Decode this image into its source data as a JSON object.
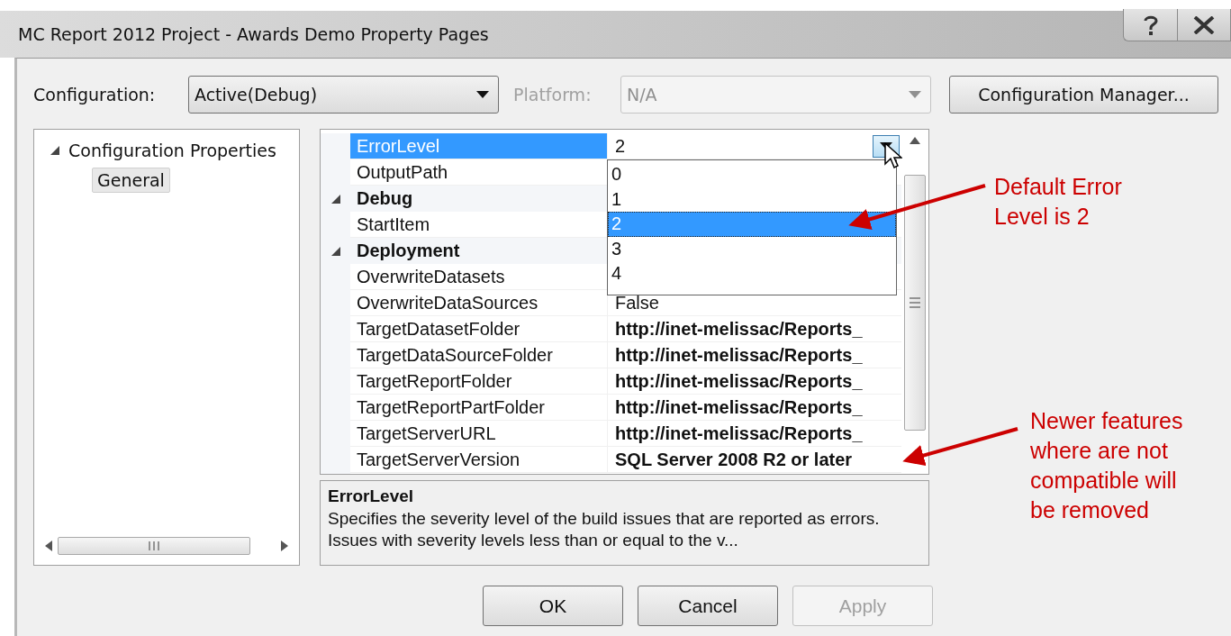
{
  "window": {
    "title": "MC Report 2012 Project - Awards Demo Property Pages"
  },
  "configuration": {
    "label": "Configuration:",
    "value": "Active(Debug)",
    "disabled": false
  },
  "platform": {
    "label": "Platform:",
    "value": "N/A",
    "disabled": true
  },
  "configuration_manager": {
    "label": "Configuration Manager..."
  },
  "tree": {
    "items": [
      {
        "label": "Configuration Properties",
        "expanded": true,
        "children": [
          {
            "label": "General",
            "selected": true
          }
        ]
      }
    ]
  },
  "grid": {
    "rows": [
      {
        "kind": "property",
        "name": "ErrorLevel",
        "value": "2",
        "selected": true,
        "modified": false,
        "editor": true
      },
      {
        "kind": "property",
        "name": "OutputPath",
        "selected": false
      },
      {
        "kind": "category",
        "name": "Debug",
        "expanded": true
      },
      {
        "kind": "property",
        "name": "StartItem",
        "selected": false
      },
      {
        "kind": "category",
        "name": "Deployment",
        "expanded": true
      },
      {
        "kind": "property",
        "name": "OverwriteDatasets",
        "selected": false
      },
      {
        "kind": "property",
        "name": "OverwriteDataSources",
        "value": "False",
        "selected": false,
        "modified": false
      },
      {
        "kind": "property",
        "name": "TargetDatasetFolder",
        "value": "http://inet-melissac/Reports_",
        "selected": false,
        "modified": true
      },
      {
        "kind": "property",
        "name": "TargetDataSourceFolder",
        "value": "http://inet-melissac/Reports_",
        "selected": false,
        "modified": true
      },
      {
        "kind": "property",
        "name": "TargetReportFolder",
        "value": "http://inet-melissac/Reports_",
        "selected": false,
        "modified": true
      },
      {
        "kind": "property",
        "name": "TargetReportPartFolder",
        "value": "http://inet-melissac/Reports_",
        "selected": false,
        "modified": true
      },
      {
        "kind": "property",
        "name": "TargetServerURL",
        "value": "http://inet-melissac/Reports_",
        "selected": false,
        "modified": true
      },
      {
        "kind": "property",
        "name": "TargetServerVersion",
        "value": "SQL Server 2008 R2 or later",
        "selected": false,
        "modified": true
      }
    ]
  },
  "dropdown": {
    "options": [
      {
        "label": "0",
        "selected": false
      },
      {
        "label": "1",
        "selected": false
      },
      {
        "label": "2",
        "selected": true
      },
      {
        "label": "3",
        "selected": false
      },
      {
        "label": "4",
        "selected": false
      }
    ]
  },
  "description": {
    "title": "ErrorLevel",
    "text": "Specifies the severity level of the build issues that are reported as errors. Issues with severity levels less than or equal to the v..."
  },
  "buttons": [
    {
      "label": "OK",
      "disabled": false
    },
    {
      "label": "Cancel",
      "disabled": false
    },
    {
      "label": "Apply",
      "disabled": true
    }
  ],
  "annotations": [
    {
      "text": "Default Error\nLevel is 2"
    },
    {
      "text": "Newer features\nwhere are not\ncompatible will\nbe removed"
    }
  ]
}
